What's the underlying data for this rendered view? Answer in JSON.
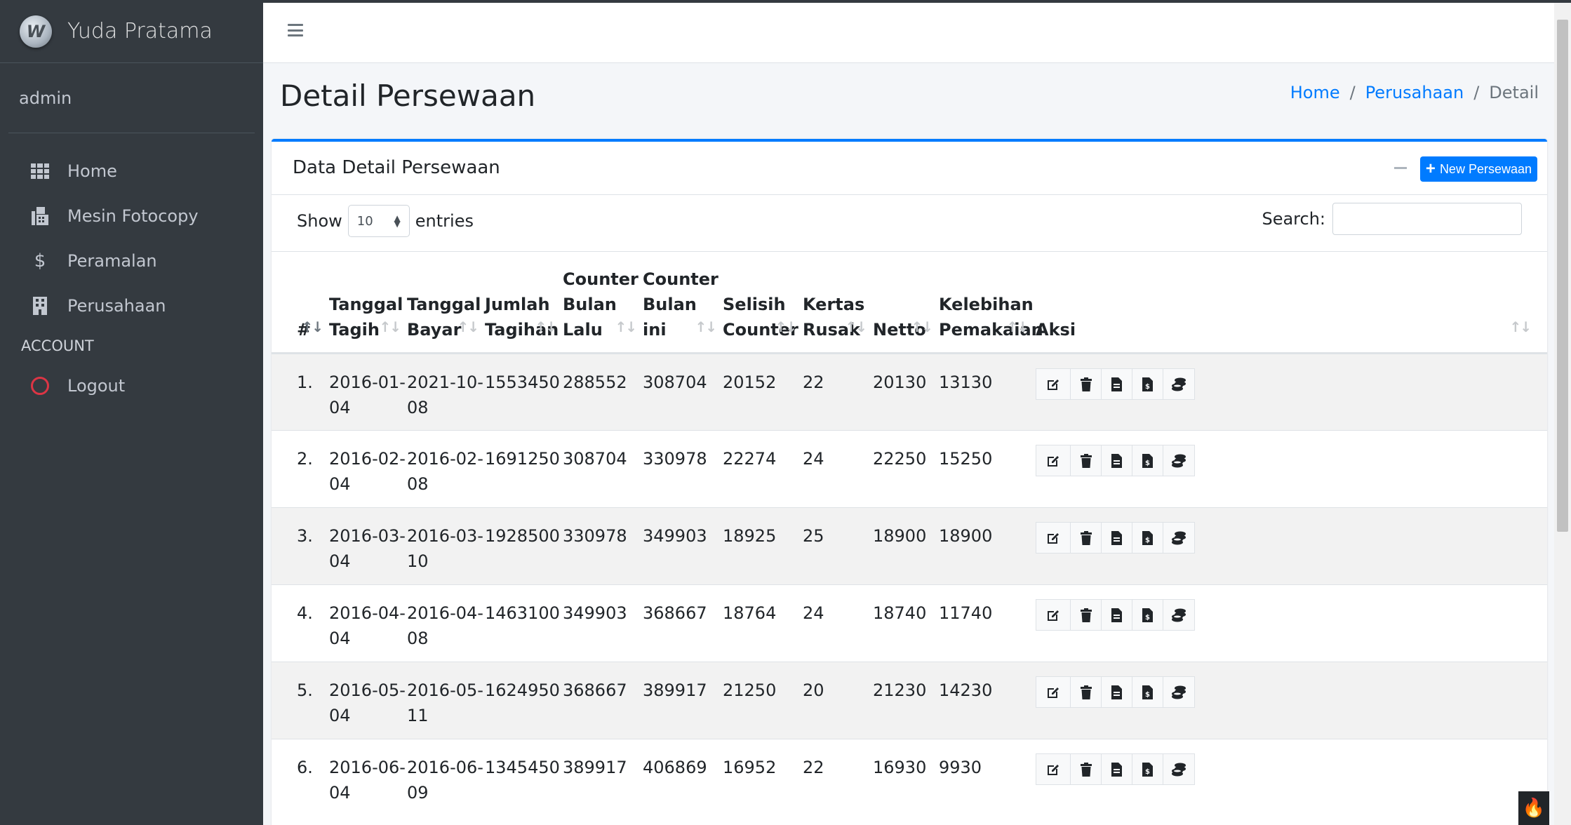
{
  "sidebar": {
    "brand": "Yuda Pratama",
    "user": "admin",
    "items": [
      {
        "label": "Home",
        "icon": "grid-icon"
      },
      {
        "label": "Mesin Fotocopy",
        "icon": "fax-icon"
      },
      {
        "label": "Peramalan",
        "icon": "dollar-icon"
      },
      {
        "label": "Perusahaan",
        "icon": "building-icon"
      }
    ],
    "section_header": "ACCOUNT",
    "logout": "Logout"
  },
  "header": {
    "menu_icon": "hamburger-icon"
  },
  "page": {
    "title": "Detail Persewaan",
    "breadcrumb": {
      "home": "Home",
      "perusahaan": "Perusahaan",
      "current": "Detail"
    }
  },
  "card": {
    "title": "Data Detail Persewaan",
    "new_button": "New Persewaan",
    "show_label": "Show",
    "page_size": "10",
    "entries_label": "entries",
    "search_label": "Search:",
    "search_value": ""
  },
  "table": {
    "headers": {
      "no": "#",
      "tagih1": "Tanggal",
      "tagih2": "Tagih",
      "bayar1": "Tanggal",
      "bayar2": "Bayar",
      "jumlah1": "Jumlah",
      "jumlah2": "Tagihan",
      "lalu1": "Counter",
      "lalu2": "Bulan",
      "lalu3": "Lalu",
      "ini1": "Counter",
      "ini2": "Bulan",
      "ini3": "ini",
      "selisih1": "Selisih",
      "selisih2": "Counter",
      "rusak1": "Kertas",
      "rusak2": "Rusak",
      "netto": "Netto",
      "lebih1": "Kelebihan",
      "lebih2": "Pemakaian",
      "aksi": "Aksi"
    },
    "rows": [
      {
        "no": "1.",
        "tagih_a": "2016-01-",
        "tagih_b": "04",
        "bayar_a": "2021-10-",
        "bayar_b": "08",
        "jumlah": "1553450",
        "lalu": "288552",
        "ini": "308704",
        "selisih": "20152",
        "rusak": "22",
        "netto": "20130",
        "lebih": "13130"
      },
      {
        "no": "2.",
        "tagih_a": "2016-02-",
        "tagih_b": "04",
        "bayar_a": "2016-02-",
        "bayar_b": "08",
        "jumlah": "1691250",
        "lalu": "308704",
        "ini": "330978",
        "selisih": "22274",
        "rusak": "24",
        "netto": "22250",
        "lebih": "15250"
      },
      {
        "no": "3.",
        "tagih_a": "2016-03-",
        "tagih_b": "04",
        "bayar_a": "2016-03-",
        "bayar_b": "10",
        "jumlah": "1928500",
        "lalu": "330978",
        "ini": "349903",
        "selisih": "18925",
        "rusak": "25",
        "netto": "18900",
        "lebih": "18900"
      },
      {
        "no": "4.",
        "tagih_a": "2016-04-",
        "tagih_b": "04",
        "bayar_a": "2016-04-",
        "bayar_b": "08",
        "jumlah": "1463100",
        "lalu": "349903",
        "ini": "368667",
        "selisih": "18764",
        "rusak": "24",
        "netto": "18740",
        "lebih": "11740"
      },
      {
        "no": "5.",
        "tagih_a": "2016-05-",
        "tagih_b": "04",
        "bayar_a": "2016-05-",
        "bayar_b": "11",
        "jumlah": "1624950",
        "lalu": "368667",
        "ini": "389917",
        "selisih": "21250",
        "rusak": "20",
        "netto": "21230",
        "lebih": "14230"
      },
      {
        "no": "6.",
        "tagih_a": "2016-06-",
        "tagih_b": "04",
        "bayar_a": "2016-06-",
        "bayar_b": "09",
        "jumlah": "1345450",
        "lalu": "389917",
        "ini": "406869",
        "selisih": "16952",
        "rusak": "22",
        "netto": "16930",
        "lebih": "9930"
      }
    ],
    "action_icons": [
      "edit-icon",
      "trash-icon",
      "file-icon",
      "file-invoice-icon",
      "coins-icon"
    ]
  },
  "colors": {
    "sidebar_bg": "#343a40",
    "primary": "#007bff",
    "danger": "#dc3545"
  }
}
